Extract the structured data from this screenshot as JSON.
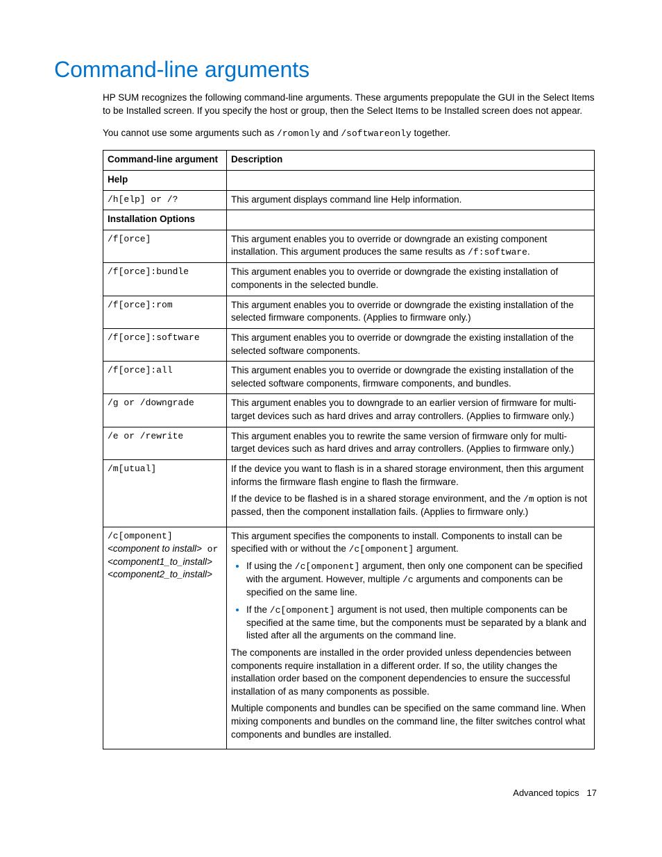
{
  "title": "Command-line arguments",
  "intro": "HP SUM recognizes the following command-line arguments. These arguments prepopulate the GUI in the Select Items to be Installed screen. If you specify the host or group, then the Select Items to be Installed screen does not appear.",
  "intro2": {
    "part1": "You cannot use some arguments such as ",
    "code1": "/romonly",
    "mid": " and ",
    "code2": "/softwareonly",
    "part2": " together."
  },
  "header": {
    "col1": "Command-line argument",
    "col2": "Description"
  },
  "sections": {
    "help": "Help",
    "install": "Installation Options"
  },
  "rows": {
    "help_arg": "/h[elp] or /?",
    "help_desc": "This argument displays command line Help information.",
    "force_arg": "/f[orce]",
    "force_desc": {
      "p1": "This argument enables you to override or downgrade an existing component installation. This argument produces the same results as ",
      "c": "/f:software",
      "p2": "."
    },
    "bundle_arg": "/f[orce]:bundle",
    "bundle_desc": "This argument enables you to override or downgrade the existing installation of components in the selected bundle.",
    "rom_arg": "/f[orce]:rom",
    "rom_desc": "This argument enables you to override or downgrade the existing installation of the selected firmware components. (Applies to firmware only.)",
    "software_arg": "/f[orce]:software",
    "software_desc": "This argument enables you to override or downgrade the existing installation of the selected software components.",
    "all_arg": "/f[orce]:all",
    "all_desc": "This argument enables you to override or downgrade the existing installation of the selected software components, firmware components, and bundles.",
    "downgrade_arg": "/g or /downgrade",
    "downgrade_desc": "This argument enables you to downgrade to an earlier version of firmware for multi-target devices such as hard drives and array controllers. (Applies to firmware only.)",
    "rewrite_arg": "/e or /rewrite",
    "rewrite_desc": "This argument enables you to rewrite the same version of firmware only for multi-target devices such as hard drives and array controllers. (Applies to firmware only.)",
    "mutual_arg": "/m[utual]",
    "mutual_desc": {
      "p1": "If the device you want to flash is in a shared storage environment, then this argument informs the firmware flash engine to flash the firmware.",
      "p2a": "If the device to be flashed is in a shared storage environment, and the ",
      "c": "/m",
      "p2b": " option is not passed, then the component installation fails. (Applies to firmware only.)"
    },
    "component_arg": {
      "l1": "/c[omponent]",
      "l2a": "<component to install>",
      "l2b": " or",
      "l3": "<component1_to_install>",
      "l4": "<component2_to_install>"
    },
    "component_desc": {
      "p1a": "This argument specifies the components to install. Components to install can be specified with or without the ",
      "c1": "/c[omponent]",
      "p1b": " argument.",
      "li1a": "If using the ",
      "li1c": "/c[omponent]",
      "li1b": " argument, then only one component can be specified with the argument. However, multiple ",
      "li1c2": "/c",
      "li1d": " arguments and components can be specified on the same line.",
      "li2a": "If the ",
      "li2c": "/c[omponent]",
      "li2b": " argument is not used, then multiple components can be specified at the same time, but the components must be separated by a blank and listed after all the arguments on the command line.",
      "p2": "The components are installed in the order provided unless dependencies between components require installation in a different order. If so, the utility changes the installation order based on the component dependencies to ensure the successful installation of as many components as possible.",
      "p3": "Multiple components and bundles can be specified on the same command line. When mixing components and bundles on the command line, the filter switches control what components and bundles are installed."
    }
  },
  "footer": {
    "label": "Advanced topics",
    "page": "17"
  }
}
